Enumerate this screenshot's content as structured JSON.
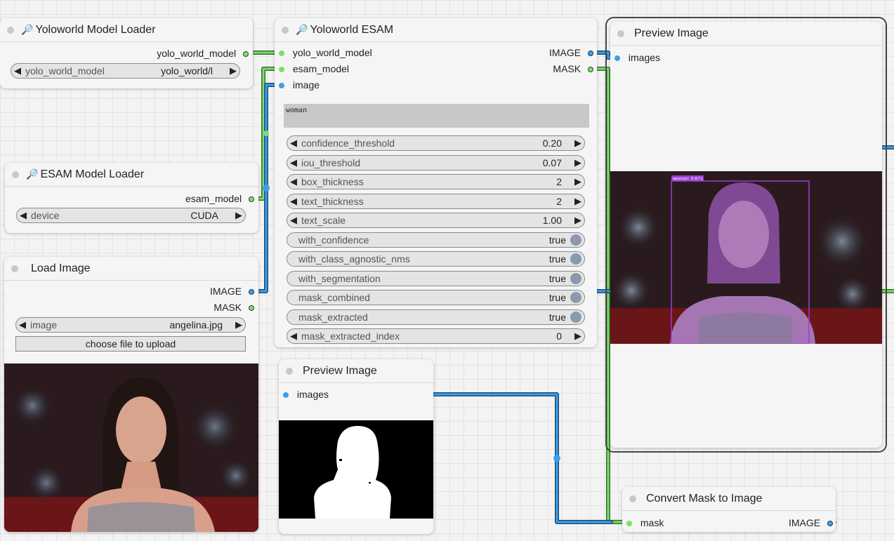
{
  "yolo_loader": {
    "icon": "🔎",
    "title": "Yoloworld Model Loader",
    "output": "yolo_world_model",
    "widget_label": "yolo_world_model",
    "widget_value": "yolo_world/l"
  },
  "esam_loader": {
    "icon": "🔎",
    "title": "ESAM Model Loader",
    "output": "esam_model",
    "widget_label": "device",
    "widget_value": "CUDA"
  },
  "load_image": {
    "title": "Load Image",
    "outputs": [
      "IMAGE",
      "MASK"
    ],
    "widget_label": "image",
    "widget_value": "angelina.jpg",
    "upload_label": "choose file to upload"
  },
  "esam": {
    "icon": "🔎",
    "title": "Yoloworld ESAM",
    "inputs": [
      "yolo_world_model",
      "esam_model",
      "image"
    ],
    "outputs": [
      "IMAGE",
      "MASK"
    ],
    "prompt_text": "woman",
    "sliders": [
      {
        "label": "confidence_threshold",
        "value": "0.20"
      },
      {
        "label": "iou_threshold",
        "value": "0.07"
      },
      {
        "label": "box_thickness",
        "value": "2"
      },
      {
        "label": "text_thickness",
        "value": "2"
      },
      {
        "label": "text_scale",
        "value": "1.00"
      }
    ],
    "toggles": [
      {
        "label": "with_confidence",
        "value": "true"
      },
      {
        "label": "with_class_agnostic_nms",
        "value": "true"
      },
      {
        "label": "with_segmentation",
        "value": "true"
      },
      {
        "label": "mask_combined",
        "value": "true"
      },
      {
        "label": "mask_extracted",
        "value": "true"
      }
    ],
    "last_slider": {
      "label": "mask_extracted_index",
      "value": "0"
    }
  },
  "preview_small": {
    "title": "Preview Image",
    "input": "images"
  },
  "preview_large": {
    "title": "Preview Image",
    "input": "images",
    "detection_label": "woman: 0.671"
  },
  "convert_mask": {
    "title": "Convert Mask to Image",
    "input": "mask",
    "output": "IMAGE"
  },
  "colors": {
    "link_green": "#7be06a",
    "link_blue": "#3e9fe8",
    "node_bg": "#f5f5f5",
    "widget_bg": "#e4e4e4"
  }
}
